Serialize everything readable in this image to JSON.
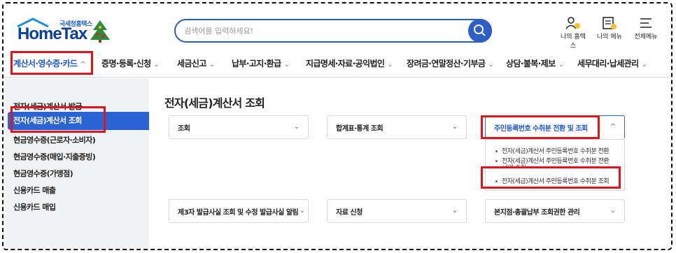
{
  "header": {
    "logo_small": "국세청홈택스",
    "logo_big": "HomeTax",
    "search_placeholder": "검색어를 입력하세요!",
    "icons": [
      {
        "icon": "person-home-icon",
        "label": "나의 홈택스"
      },
      {
        "icon": "my-menu-icon",
        "label": "나의 메뉴"
      },
      {
        "icon": "hamburger-menu-icon",
        "label": "전체메뉴"
      }
    ]
  },
  "nav": {
    "items": [
      {
        "label": "계산서·영수증·카드",
        "chevron": "^"
      },
      {
        "label": "증명·등록·신청",
        "chevron": "⌄"
      },
      {
        "label": "세금신고",
        "chevron": "⌄"
      },
      {
        "label": "납부·고지·환급",
        "chevron": "⌄"
      },
      {
        "label": "지급명세·자료·공익법인",
        "chevron": "⌄"
      },
      {
        "label": "장려금·연말정산·기부금",
        "chevron": "⌄"
      },
      {
        "label": "상담·불복·제보",
        "chevron": "⌄"
      },
      {
        "label": "세무대리·납세관리",
        "chevron": "⌄"
      }
    ],
    "active_index": 0
  },
  "sidebar": {
    "items": [
      {
        "label": "전자(세금)계산서 발급"
      },
      {
        "label": "전자(세금)계산서 조회"
      },
      {
        "label": "현금영수증(근로자·소비자)"
      },
      {
        "label": "현금영수증(매입·지출증빙)"
      },
      {
        "label": "현금영수증(가맹점)"
      },
      {
        "label": "신용카드 매출"
      },
      {
        "label": "신용카드 매입"
      }
    ],
    "active_index": 1
  },
  "main": {
    "title": "전자(세금)계산서 조회",
    "cards": [
      {
        "label": "조회",
        "chevron": "⌄"
      },
      {
        "label": "합계표·통계 조회",
        "chevron": "⌄"
      },
      {
        "label": "주민등록번호 수취분 전환 및 조회",
        "chevron": "^"
      },
      {
        "label": "제3자 발급사실 조회 및 수정 발급사실 알림",
        "chevron": "⌄"
      },
      {
        "label": "자료 신청",
        "chevron": "⌄"
      },
      {
        "label": "본지점·총괄납부 조회권한 관리",
        "chevron": "⌄"
      }
    ],
    "dropdown_items": [
      {
        "label": "전자(세금)계산서 주민등록번호 수취분 전환"
      },
      {
        "label": "전자(세금)계산서 주민등록번호 수취분 전환"
      },
      {
        "label": "내역 조회"
      },
      {
        "label": "전자(세금)계산서 주민등록번호 수취분 조회"
      }
    ]
  },
  "colors": {
    "accent": "#2a63d4",
    "annotation_red": "#e0141b",
    "sidebar_bg": "#f1f2f4"
  }
}
